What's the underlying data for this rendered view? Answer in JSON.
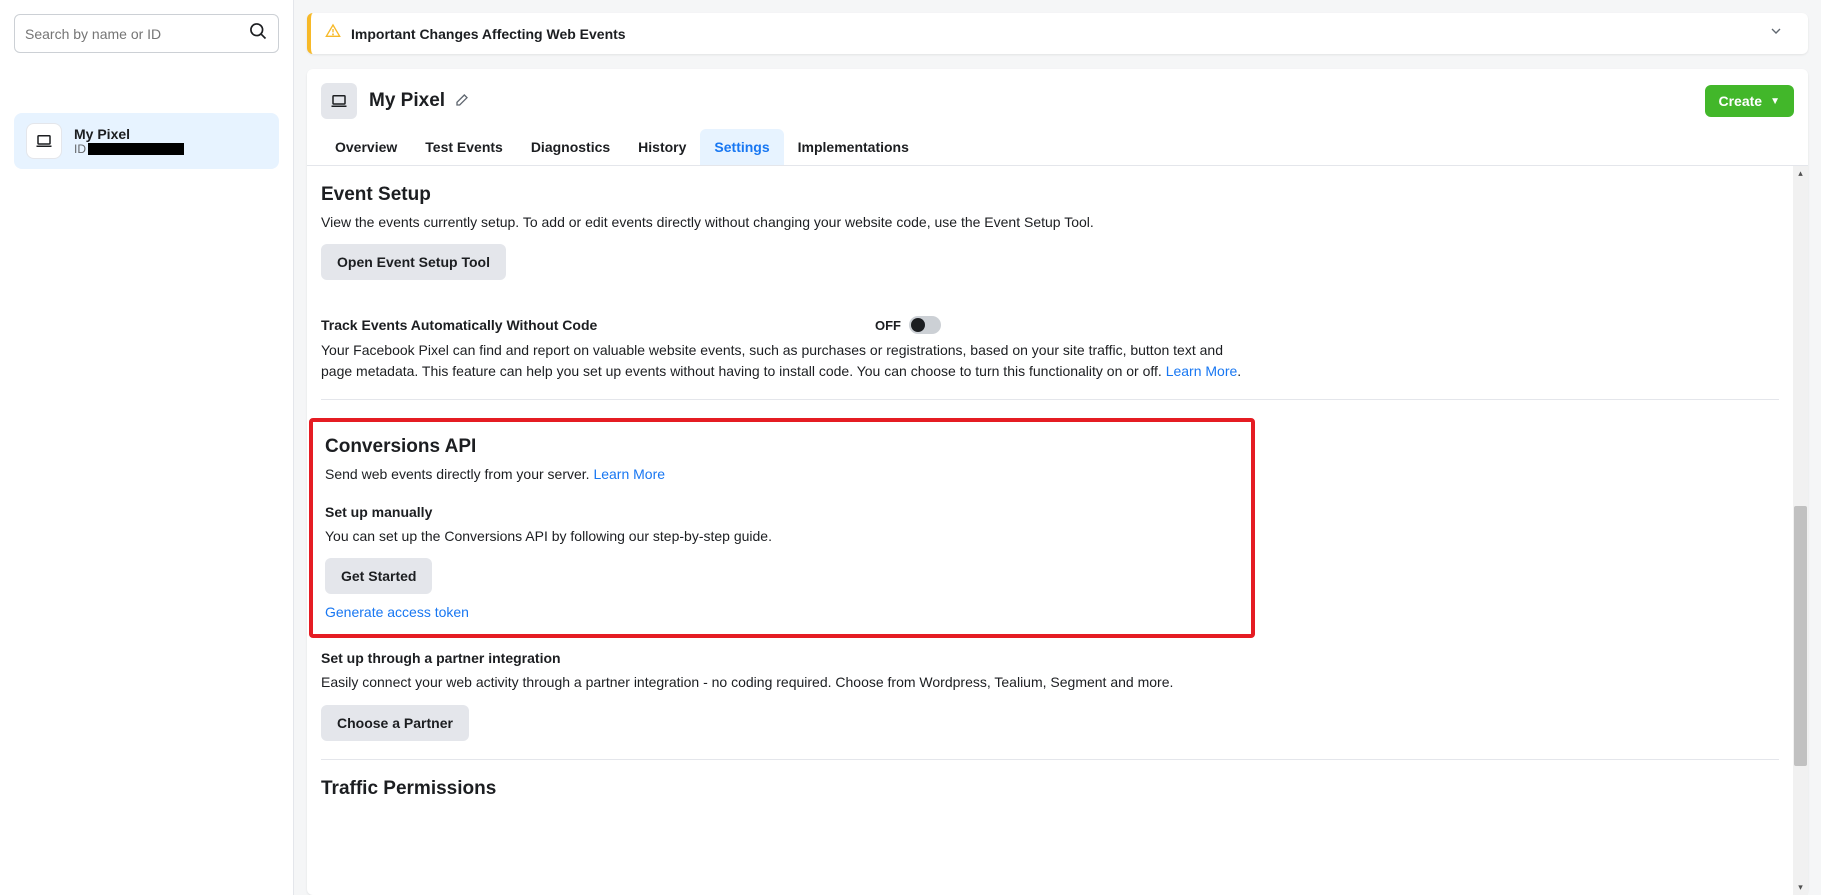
{
  "sidebar": {
    "search_placeholder": "Search by name or ID",
    "item": {
      "title": "My Pixel",
      "id_label": "ID"
    }
  },
  "alert": {
    "title": "Important Changes Affecting Web Events"
  },
  "header": {
    "title": "My Pixel",
    "create_label": "Create"
  },
  "tabs": {
    "overview": "Overview",
    "test_events": "Test Events",
    "diagnostics": "Diagnostics",
    "history": "History",
    "settings": "Settings",
    "implementations": "Implementations"
  },
  "event_setup": {
    "title": "Event Setup",
    "desc": "View the events currently setup. To add or edit events directly without changing your website code, use the Event Setup Tool.",
    "btn": "Open Event Setup Tool"
  },
  "track": {
    "title": "Track Events Automatically Without Code",
    "toggle_state": "OFF",
    "desc": "Your Facebook Pixel can find and report on valuable website events, such as purchases or registrations, based on your site traffic, button text and page metadata. This feature can help you set up events without having to install code. You can choose to turn this functionality on or off. ",
    "learn_more": "Learn More"
  },
  "conversions": {
    "title": "Conversions API",
    "desc": "Send web events directly from your server. ",
    "learn_more": "Learn More",
    "manual_title": "Set up manually",
    "manual_desc": "You can set up the Conversions API by following our step-by-step guide.",
    "get_started": "Get Started",
    "generate_token": "Generate access token",
    "partner_title": "Set up through a partner integration",
    "partner_desc": "Easily connect your web activity through a partner integration - no coding required. Choose from Wordpress, Tealium, Segment and more.",
    "choose_partner": "Choose a Partner"
  },
  "traffic": {
    "title": "Traffic Permissions"
  }
}
